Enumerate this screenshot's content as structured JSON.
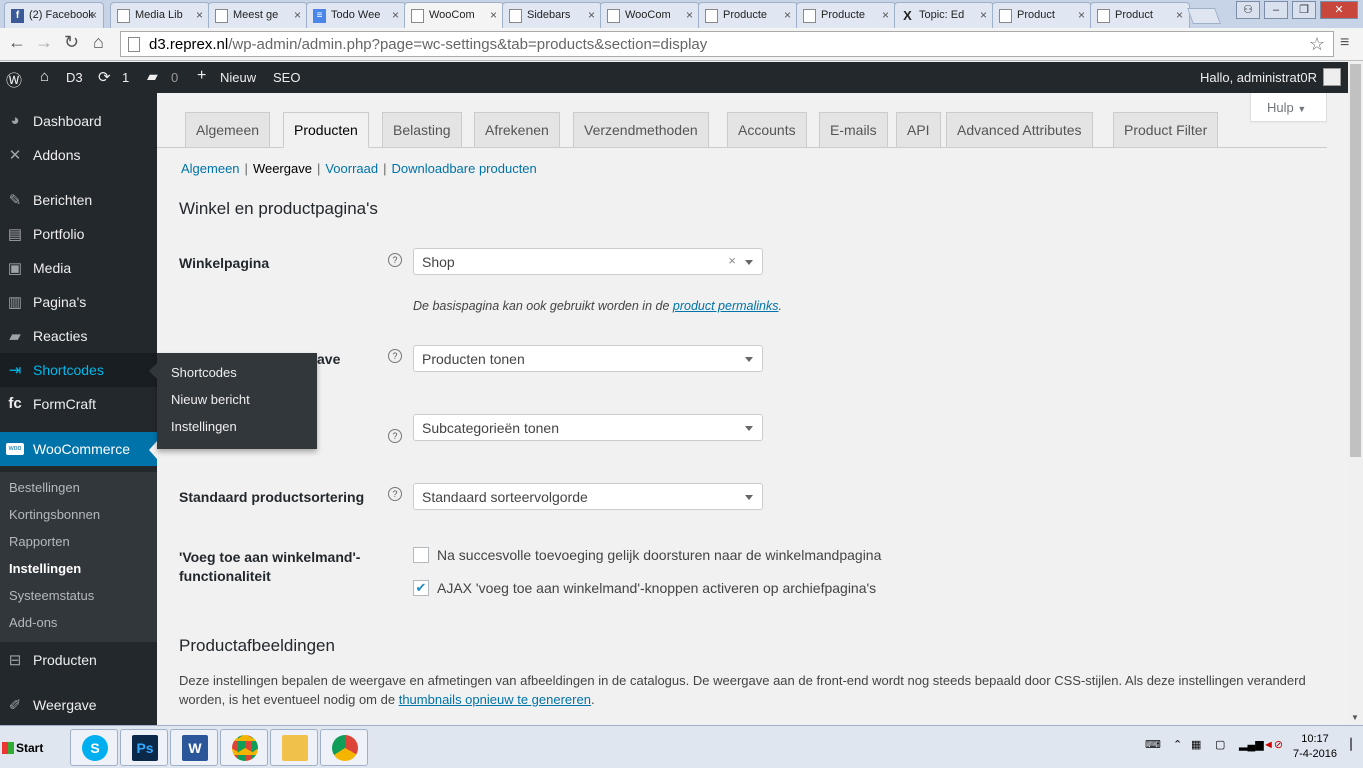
{
  "browser": {
    "tabs": [
      {
        "label": "(2) Facebook",
        "icon": "facebook-icon"
      },
      {
        "label": "Media Lib",
        "icon": "doc-icon"
      },
      {
        "label": "Meest ge",
        "icon": "doc-icon"
      },
      {
        "label": "Todo Wee",
        "icon": "docs-icon"
      },
      {
        "label": "WooCom",
        "icon": "doc-icon"
      },
      {
        "label": "Sidebars",
        "icon": "doc-icon"
      },
      {
        "label": "WooCom",
        "icon": "doc-icon"
      },
      {
        "label": "Producte",
        "icon": "doc-icon"
      },
      {
        "label": "Producte",
        "icon": "doc-icon"
      },
      {
        "label": "Topic: Ed",
        "icon": "x-icon"
      },
      {
        "label": "Product",
        "icon": "doc-icon"
      },
      {
        "label": "Product",
        "icon": "doc-icon"
      }
    ],
    "url_host": "d3.reprex.nl",
    "url_rest": "/wp-admin/admin.php?page=wc-settings&tab=products&section=display"
  },
  "adminbar": {
    "site": "D3",
    "updates": "1",
    "comments": "0",
    "new": "Nieuw",
    "seo": "SEO",
    "greeting": "Hallo, administrat0R"
  },
  "sidebar": {
    "items": [
      {
        "label": "Dashboard",
        "icon": "dashboard-icon"
      },
      {
        "label": "Addons",
        "icon": "x-icon"
      },
      {
        "label": "Berichten",
        "icon": "pin-icon"
      },
      {
        "label": "Portfolio",
        "icon": "portfolio-icon"
      },
      {
        "label": "Media",
        "icon": "media-icon"
      },
      {
        "label": "Pagina's",
        "icon": "pages-icon"
      },
      {
        "label": "Reacties",
        "icon": "comment-icon"
      },
      {
        "label": "Shortcodes",
        "icon": "shortcodes-icon"
      },
      {
        "label": "FormCraft",
        "icon": "formcraft-icon"
      },
      {
        "label": "WooCommerce",
        "icon": "woo-icon"
      },
      {
        "label": "Producten",
        "icon": "cart-icon"
      },
      {
        "label": "Weergave",
        "icon": "brush-icon"
      }
    ],
    "woo_sub": [
      "Bestellingen",
      "Kortingsbonnen",
      "Rapporten",
      "Instellingen",
      "Systeemstatus",
      "Add-ons"
    ],
    "flyout": [
      "Shortcodes",
      "Nieuw bericht",
      "Instellingen"
    ]
  },
  "content": {
    "help": "Hulp",
    "tabs": [
      "Algemeen",
      "Producten",
      "Belasting",
      "Afrekenen",
      "Verzendmethoden",
      "Accounts",
      "E-mails",
      "API",
      "Advanced Attributes",
      "Product Filter"
    ],
    "sublinks": [
      "Algemeen",
      "Weergave",
      "Voorraad",
      "Downloadbare producten"
    ],
    "section1": "Winkel en productpagina's",
    "winkelpagina": {
      "label": "Winkelpagina",
      "value": "Shop",
      "desc": "De basispagina kan ook gebruikt worden in de ",
      "desc_link": "product permalinks",
      "desc_end": "."
    },
    "row2": {
      "label_visible": "ave",
      "value": "Producten tonen"
    },
    "row3": {
      "value": "Subcategorieën tonen"
    },
    "sorting": {
      "label": "Standaard productsortering",
      "value": "Standaard sorteervolgorde"
    },
    "cart": {
      "label": "'Voeg toe aan winkelmand'-functionaliteit",
      "opt1": "Na succesvolle toevoeging gelijk doorsturen naar de winkelmandpagina",
      "opt1_checked": false,
      "opt2": "AJAX 'voeg toe aan winkelmand'-knoppen activeren op archiefpagina's",
      "opt2_checked": true
    },
    "section2": "Productafbeeldingen",
    "para": "Deze instellingen bepalen de weergave en afmetingen van afbeeldingen in de catalogus. De weergave aan de front-end wordt nog steeds bepaald door CSS-stijlen. Als deze instellingen veranderd worden, is het eventueel nodig om de ",
    "para_link": "thumbnails opnieuw te genereren",
    "para_end": "."
  },
  "taskbar": {
    "start": "Start",
    "time": "10:17",
    "date": "7-4-2016"
  }
}
